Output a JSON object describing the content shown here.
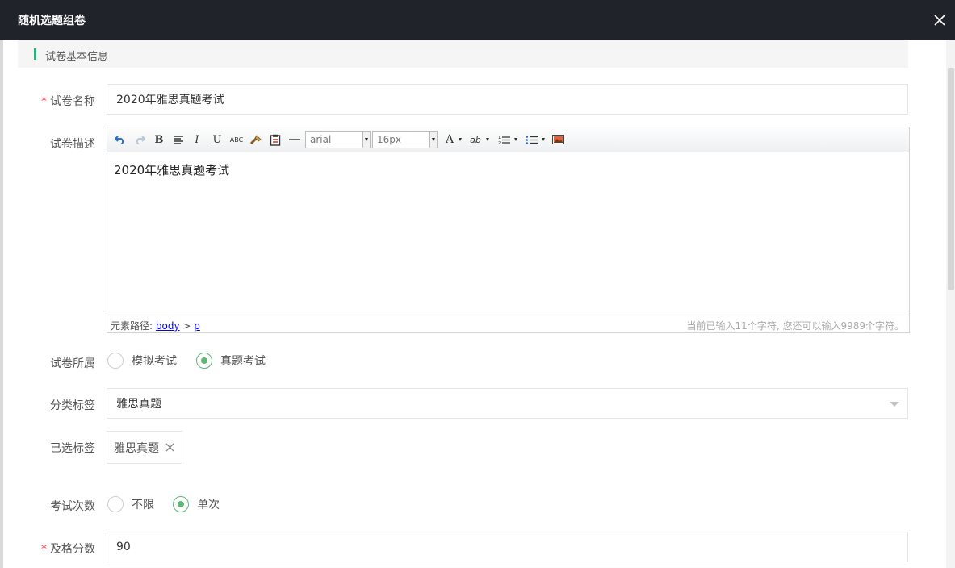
{
  "window": {
    "title": "随机选题组卷",
    "close_icon": "close-icon"
  },
  "section": {
    "title": "试卷基本信息",
    "accent": "#1fb77b"
  },
  "form": {
    "name": {
      "required_mark": "*",
      "label": "试卷名称",
      "value": "2020年雅思真题考试"
    },
    "description": {
      "label": "试卷描述",
      "toolbar": {
        "undo_icon": "undo-icon",
        "redo_icon": "redo-icon",
        "bold_glyph": "B",
        "italic_glyph": "I",
        "underline_glyph": "U",
        "strike_glyph": "ABC",
        "font_family": "arial",
        "font_size": "16px",
        "font_color_glyph": "A",
        "highlight_glyph": "ab"
      },
      "content": "2020年雅思真题考试",
      "status": {
        "path_label": "元素路径:",
        "path_body": "body",
        "path_sep": ">",
        "path_p": "p",
        "char_count": "当前已输入11个字符, 您还可以输入9989个字符。"
      }
    },
    "belongs": {
      "label": "试卷所属",
      "options": [
        "模拟考试",
        "真题考试"
      ],
      "selected": "真题考试"
    },
    "category": {
      "label": "分类标签",
      "value": "雅思真题"
    },
    "selected_tags": {
      "label": "已选标签",
      "tags": [
        "雅思真题"
      ]
    },
    "attempts": {
      "label": "考试次数",
      "options": [
        "不限",
        "单次"
      ],
      "selected": "单次"
    },
    "pass_score": {
      "required_mark": "*",
      "label": "及格分数",
      "value": "90"
    }
  },
  "colors": {
    "titlebar": "#20232a",
    "radio_checked": "#5bb974",
    "required": "#e4393c"
  }
}
